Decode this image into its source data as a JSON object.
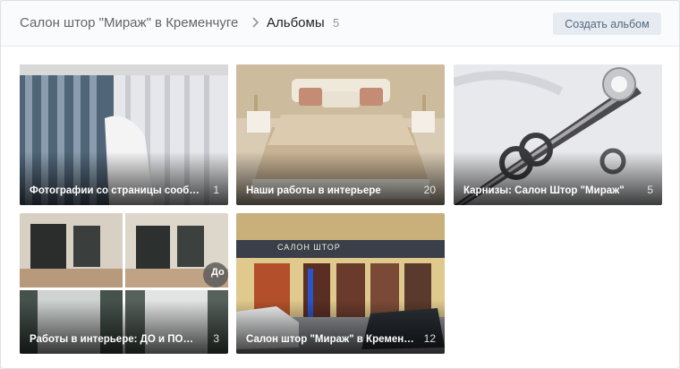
{
  "header": {
    "community": "Салон штор \"Мираж\" в Кременчуге",
    "current": "Альбомы",
    "count": "5",
    "create_button": "Создать альбом"
  },
  "albums": [
    {
      "title": "Фотографии со страницы сообщества",
      "count": "1"
    },
    {
      "title": "Наши работы в интерьере",
      "count": "20"
    },
    {
      "title": "Карнизы: Салон Штор \"Мираж\"",
      "count": "5"
    },
    {
      "title": "Работы в интерьере: ДО и ПОСЛЕ",
      "count": "3",
      "overlay_text": "До"
    },
    {
      "title": "Салон штор \"Мираж\" в Кременчуге",
      "count": "12",
      "signage": "САЛОН ШТОР"
    }
  ],
  "colors": {
    "accent": "#5181b8",
    "button_bg": "#e5ebf1",
    "button_text": "#55677d"
  }
}
